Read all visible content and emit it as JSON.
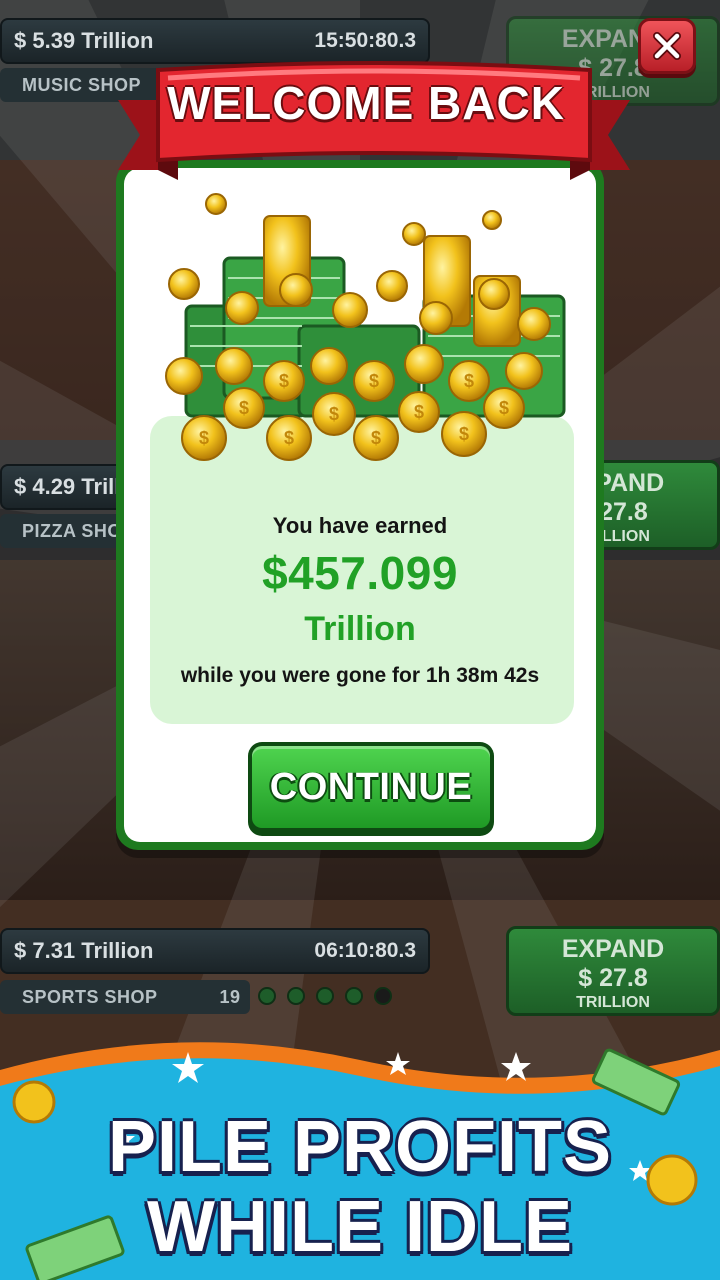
{
  "background": {
    "shops": [
      {
        "earnings": "$ 5.39 Trillion",
        "timer": "15:50:80.3",
        "name": "MUSIC SHOP",
        "expand": {
          "label": "EXPAND",
          "price": "$ 27.8",
          "unit": "TRILLION"
        }
      },
      {
        "earnings": "$ 4.29 Trillion",
        "timer": "",
        "name": "PIZZA SHOP",
        "expand": {
          "label": "EXPAND",
          "price": "$ 27.8",
          "unit": "TRILLION"
        }
      },
      {
        "earnings": "$ 7.31 Trillion",
        "timer": "06:10:80.3",
        "name": "SPORTS SHOP",
        "level": "19",
        "expand": {
          "label": "EXPAND",
          "price": "$ 27.8",
          "unit": "TRILLION"
        }
      }
    ]
  },
  "dialog": {
    "title": "WELCOME BACK",
    "earned_label": "You have earned",
    "earned_amount": "$457.099",
    "earned_unit": "Trillion",
    "away_text": "while you were gone for 1h 38m 42s",
    "continue_label": "CONTINUE"
  },
  "banner": {
    "line1": "PILE PROFITS",
    "line2": "WHILE IDLE"
  },
  "colors": {
    "dialog_border": "#1e7a1f",
    "reward_panel": "#d9f5d6",
    "amount_green": "#21a126",
    "ribbon_red": "#e3262f",
    "banner_blue": "#1fb3e0",
    "banner_orange": "#f07a1a"
  },
  "icons": [
    "close-icon",
    "coin-pile-icon",
    "cash-stack-icon",
    "star-icon",
    "coin-icon",
    "banknote-icon"
  ]
}
